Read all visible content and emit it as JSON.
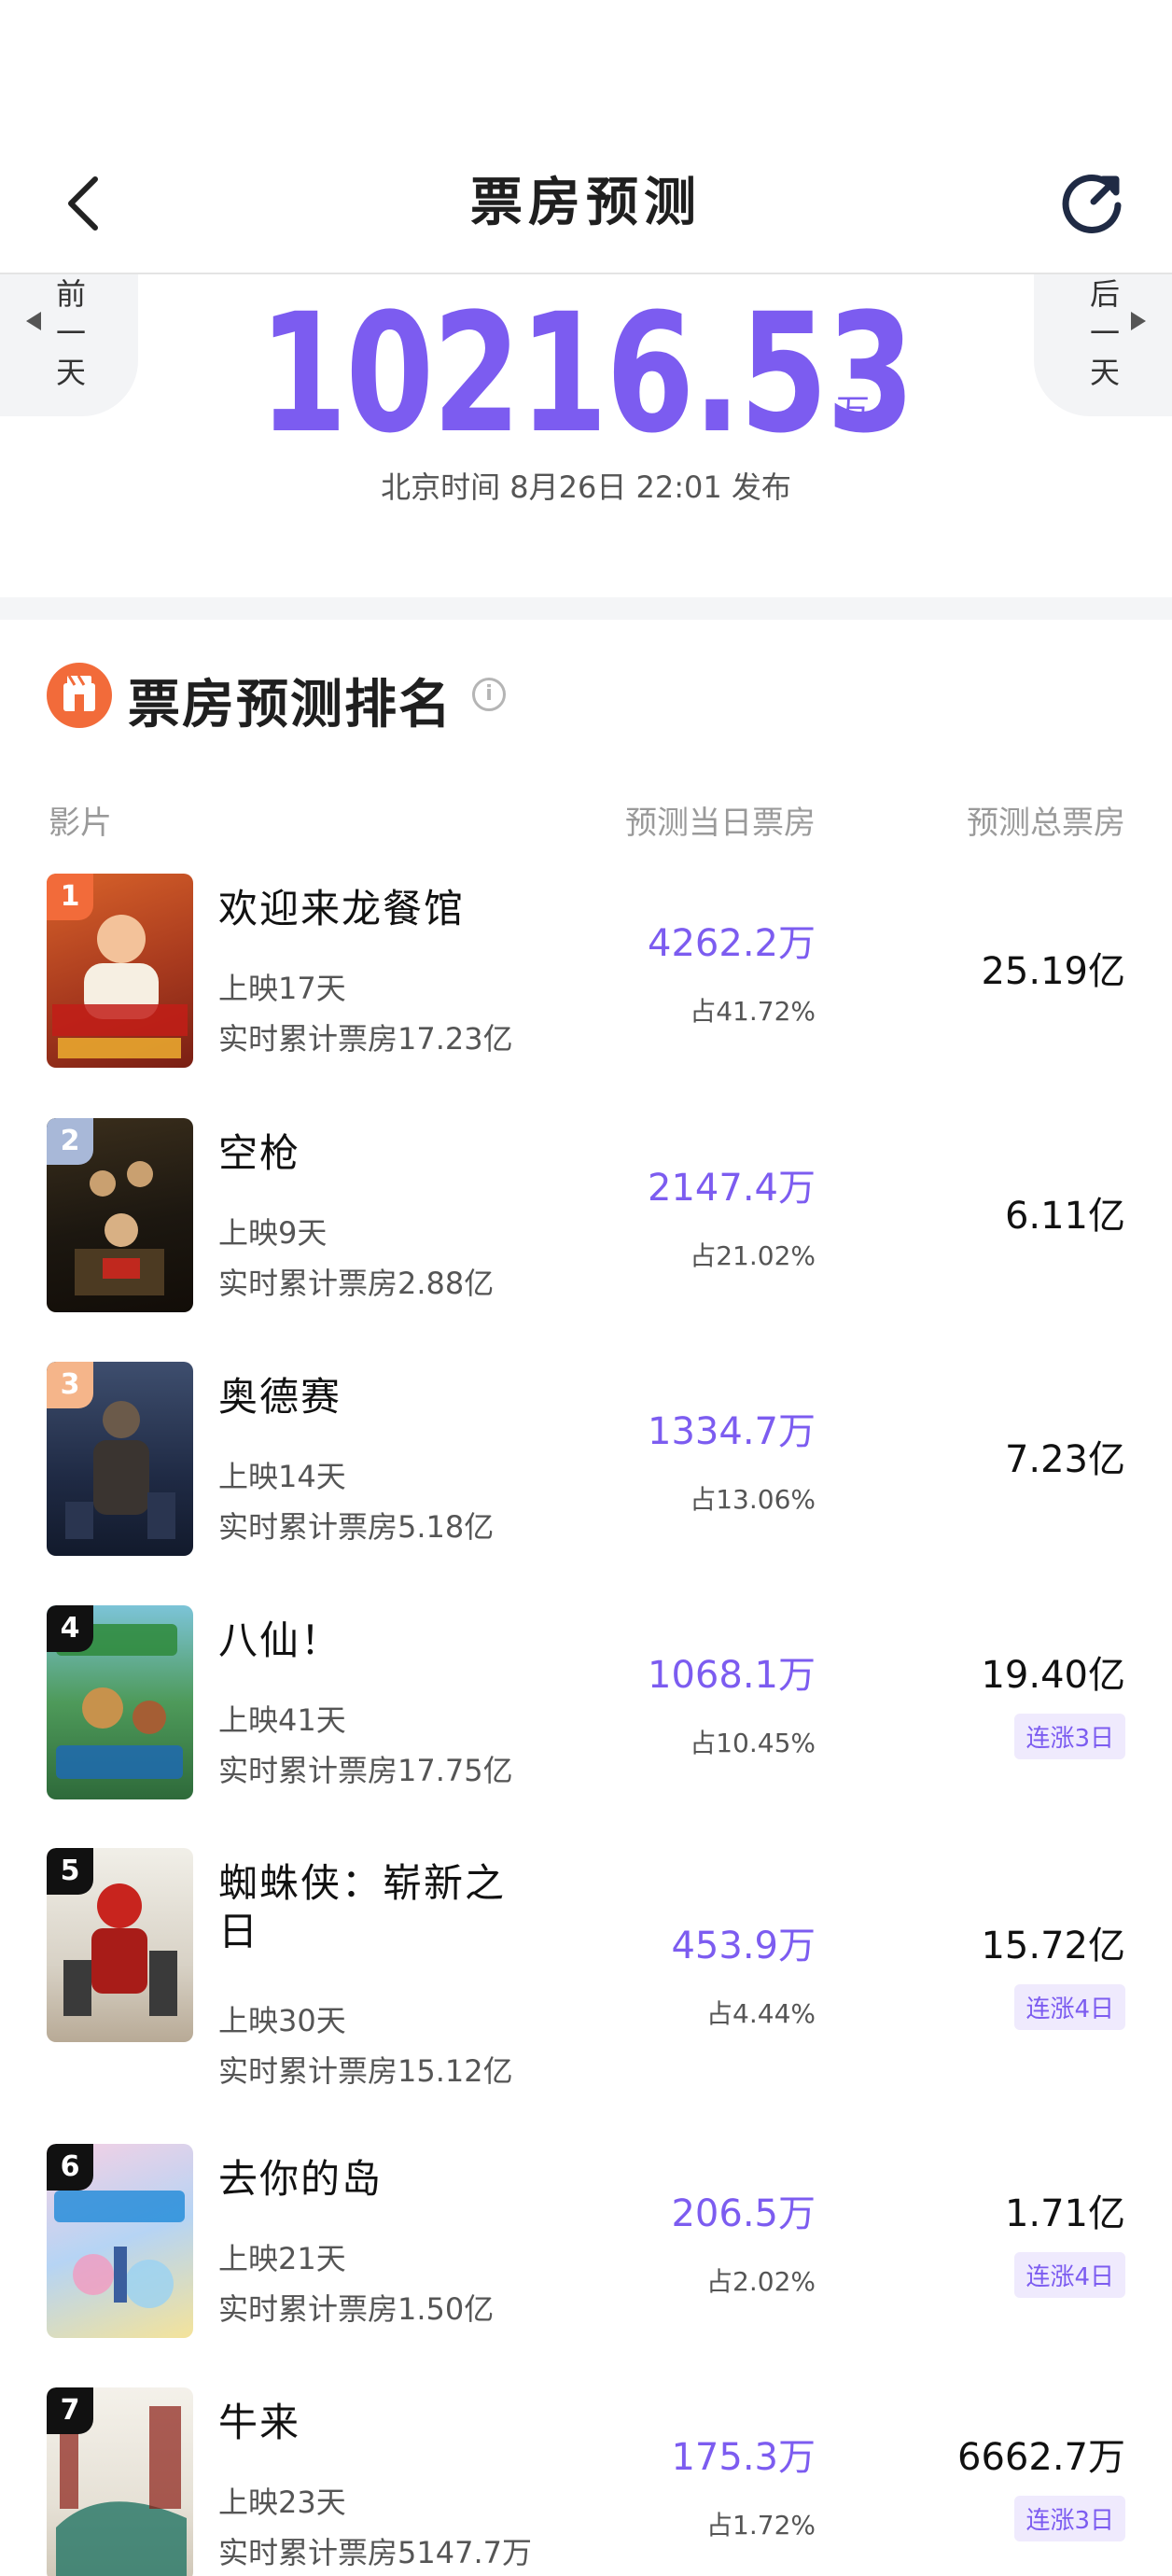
{
  "header": {
    "title": "票房预测",
    "back_icon": "back-arrow-icon",
    "refresh_icon": "refresh-icon"
  },
  "nav": {
    "prev_label": "前一天",
    "next_label": "后一天"
  },
  "summary": {
    "total_value": "10216.53",
    "unit": "万",
    "publish_text": "北京时间 8月26日 22:01 发布"
  },
  "section": {
    "title": "票房预测排名",
    "icon": "cinema-ticket-icon",
    "info_icon": "info-icon"
  },
  "columns": {
    "film": "影片",
    "day_forecast": "预测当日票房",
    "total_forecast": "预测总票房"
  },
  "colors": {
    "accent": "#7c5cf0",
    "rank1": "#f26b3a",
    "rank2": "#a8b8d8",
    "rank3": "#f5b58a",
    "rank_other": "#111111",
    "badge_bg": "#efeafd"
  },
  "films": [
    {
      "rank": "1",
      "name": "欢迎来龙餐馆",
      "days": "上映17天",
      "cumulative": "实时累计票房17.23亿",
      "day_value": "4262.2万",
      "share": "占41.72%",
      "total": "25.19亿",
      "badge": ""
    },
    {
      "rank": "2",
      "name": "空枪",
      "days": "上映9天",
      "cumulative": "实时累计票房2.88亿",
      "day_value": "2147.4万",
      "share": "占21.02%",
      "total": "6.11亿",
      "badge": ""
    },
    {
      "rank": "3",
      "name": "奥德赛",
      "days": "上映14天",
      "cumulative": "实时累计票房5.18亿",
      "day_value": "1334.7万",
      "share": "占13.06%",
      "total": "7.23亿",
      "badge": ""
    },
    {
      "rank": "4",
      "name": "八仙！",
      "days": "上映41天",
      "cumulative": "实时累计票房17.75亿",
      "day_value": "1068.1万",
      "share": "占10.45%",
      "total": "19.40亿",
      "badge": "连涨3日"
    },
    {
      "rank": "5",
      "name_line1": "蜘蛛侠：崭新之",
      "name_line2": "日",
      "days": "上映30天",
      "cumulative": "实时累计票房15.12亿",
      "day_value": "453.9万",
      "share": "占4.44%",
      "total": "15.72亿",
      "badge": "连涨4日"
    },
    {
      "rank": "6",
      "name": "去你的岛",
      "days": "上映21天",
      "cumulative": "实时累计票房1.50亿",
      "day_value": "206.5万",
      "share": "占2.02%",
      "total": "1.71亿",
      "badge": "连涨4日"
    },
    {
      "rank": "7",
      "name": "牛来",
      "days": "上映23天",
      "cumulative": "实时累计票房5147.7万",
      "day_value": "175.3万",
      "share": "占1.72%",
      "total": "6662.7万",
      "badge": "连涨3日"
    }
  ]
}
